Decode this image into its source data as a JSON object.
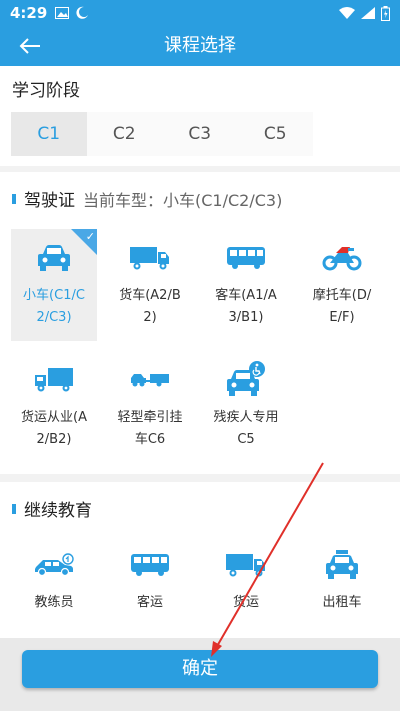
{
  "status_bar": {
    "time": "4:29",
    "icons": [
      "image-icon",
      "moon-icon",
      "wifi-icon",
      "signal-icon",
      "battery-icon"
    ]
  },
  "app_bar": {
    "title": "课程选择",
    "back_icon": "arrow-left-icon"
  },
  "stage": {
    "heading": "学习阶段",
    "tabs": [
      {
        "label": "C1",
        "active": true
      },
      {
        "label": "C2",
        "active": false
      },
      {
        "label": "C3",
        "active": false
      },
      {
        "label": "C5",
        "active": false
      }
    ]
  },
  "license": {
    "title": "驾驶证",
    "current": "当前车型：小车(C1/C2/C3)",
    "items": [
      {
        "label": "小车(C1/C2/C3)",
        "icon": "car-icon",
        "selected": true
      },
      {
        "label": "货车(A2/B2)",
        "icon": "truck-icon",
        "selected": false
      },
      {
        "label": "客车(A1/A3/B1)",
        "icon": "bus-icon",
        "selected": false
      },
      {
        "label": "摩托车(D/E/F)",
        "icon": "motorcycle-icon",
        "selected": false
      },
      {
        "label": "货运从业(A2/B2)",
        "icon": "cargo-truck-icon",
        "selected": false
      },
      {
        "label": "轻型牵引挂车C6",
        "icon": "trailer-icon",
        "selected": false
      },
      {
        "label": "残疾人专用C5",
        "icon": "accessible-car-icon",
        "selected": false
      }
    ]
  },
  "education": {
    "title": "继续教育",
    "items": [
      {
        "label": "教练员",
        "icon": "coach-car-icon"
      },
      {
        "label": "客运",
        "icon": "passenger-bus-icon"
      },
      {
        "label": "货运",
        "icon": "freight-truck-icon"
      },
      {
        "label": "出租车",
        "icon": "taxi-icon"
      }
    ]
  },
  "confirm": {
    "label": "确定"
  },
  "colors": {
    "primary": "#2a9ee0",
    "annotation_arrow": "#e0302a",
    "selected_bg": "#eeeeee"
  }
}
